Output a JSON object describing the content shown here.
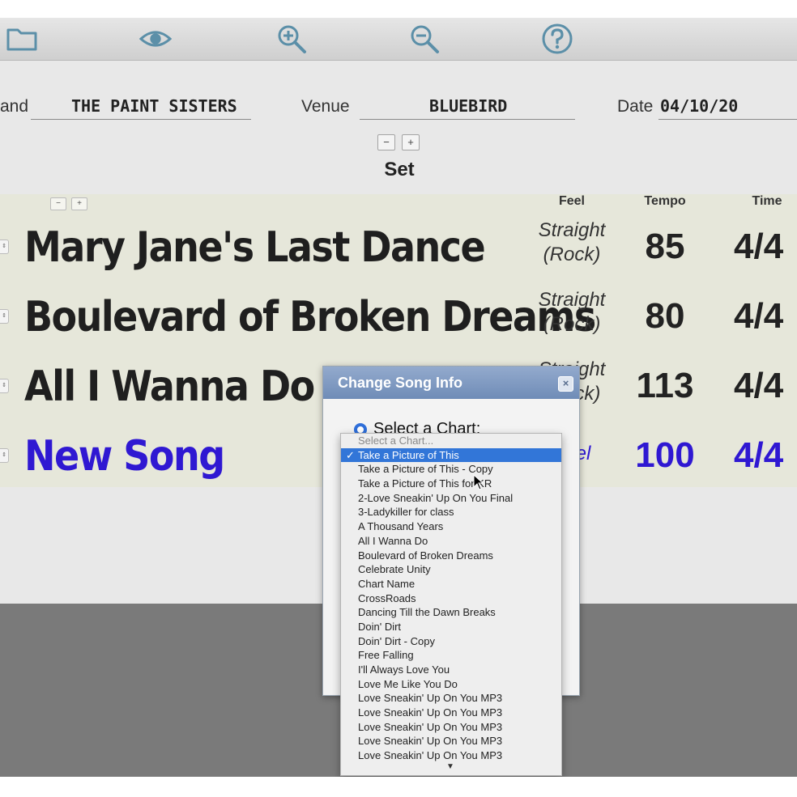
{
  "toolbar": {
    "icons": [
      "folder-icon",
      "eye-icon",
      "zoom-in-icon",
      "zoom-out-icon",
      "help-icon"
    ]
  },
  "header": {
    "band_label": "and",
    "band_value": "THE PAINT SISTERS",
    "venue_label": "Venue",
    "venue_value": "BLUEBIRD",
    "date_label": "Date",
    "date_value": "04/10/20"
  },
  "set": {
    "minus": "−",
    "plus": "+",
    "title": "Set"
  },
  "setlist": {
    "minus": "−",
    "plus": "+",
    "columns": {
      "feel": "Feel",
      "tempo": "Tempo",
      "time": "Time"
    },
    "rows": [
      {
        "title": "Mary Jane's Last Dance",
        "feel": "Straight\n(Rock)",
        "tempo": "85",
        "time": "4/4"
      },
      {
        "title": "Boulevard of Broken Dreams",
        "feel": "Straight\n(Rock)",
        "tempo": "80",
        "time": "4/4"
      },
      {
        "title": "All I Wanna Do",
        "feel": "Straight\n(Rock)",
        "tempo": "113",
        "time": "4/4"
      },
      {
        "title": "New Song",
        "feel": "Feel",
        "tempo": "100",
        "time": "4/4"
      }
    ]
  },
  "dialog": {
    "title": "Change Song Info",
    "close": "×",
    "radio_label": "Select a Chart:"
  },
  "dropdown": {
    "placeholder": "Select a Chart...",
    "selected_index": 0,
    "check": "✓",
    "items": [
      "Take a Picture of This",
      "Take a Picture of This - Copy",
      "Take a Picture of This for KR",
      "2-Love Sneakin' Up On You Final",
      "3-Ladykiller for class",
      "A Thousand Years",
      "All I Wanna Do",
      "Boulevard of Broken Dreams",
      "Celebrate Unity",
      "Chart Name",
      "CrossRoads",
      "Dancing Till the Dawn Breaks",
      "Doin' Dirt",
      "Doin' Dirt - Copy",
      "Free Falling",
      "I'll Always Love You",
      "Love Me Like You Do",
      "Love Sneakin' Up On You MP3",
      "Love Sneakin' Up On You MP3",
      "Love Sneakin' Up On You MP3",
      "Love Sneakin' Up On You MP3",
      "Love Sneakin' Up On You MP3"
    ],
    "scroll_arrow": "▼"
  },
  "colors": {
    "new_song": "#2f18d2",
    "selection": "#3276d8",
    "icon": "#5b8fa8"
  }
}
